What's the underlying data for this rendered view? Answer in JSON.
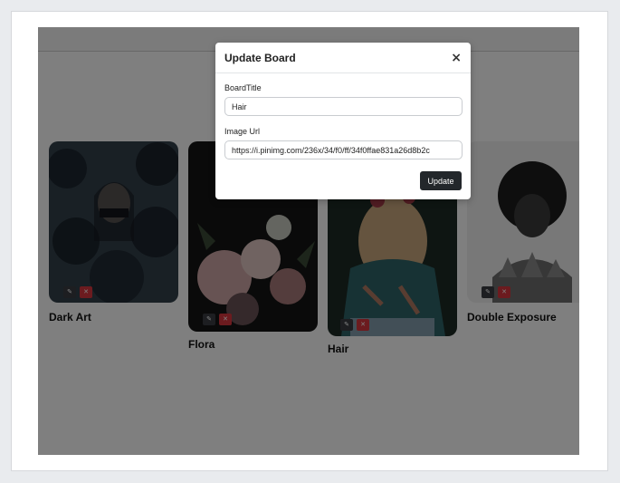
{
  "boards": [
    {
      "title": "Dark Art",
      "edit_icon": "pencil-icon",
      "delete_icon": "x-icon"
    },
    {
      "title": "Flora",
      "edit_icon": "pencil-icon",
      "delete_icon": "x-icon"
    },
    {
      "title": "Hair",
      "edit_icon": "pencil-icon",
      "delete_icon": "x-icon"
    },
    {
      "title": "Double Exposure",
      "edit_icon": "pencil-icon",
      "delete_icon": "x-icon"
    }
  ],
  "modal": {
    "title": "Update Board",
    "close_glyph": "×",
    "board_title_label": "BoardTitle",
    "board_title_value": "Hair",
    "image_url_label": "Image Url",
    "image_url_value": "https://i.pinimg.com/236x/34/f0/ff/34f0ffae831a26d8b2c",
    "submit_label": "Update"
  },
  "colors": {
    "overlay": "#000000",
    "edit_button": "#3a3d42",
    "delete_button": "#d9363e",
    "update_button": "#23272b"
  }
}
